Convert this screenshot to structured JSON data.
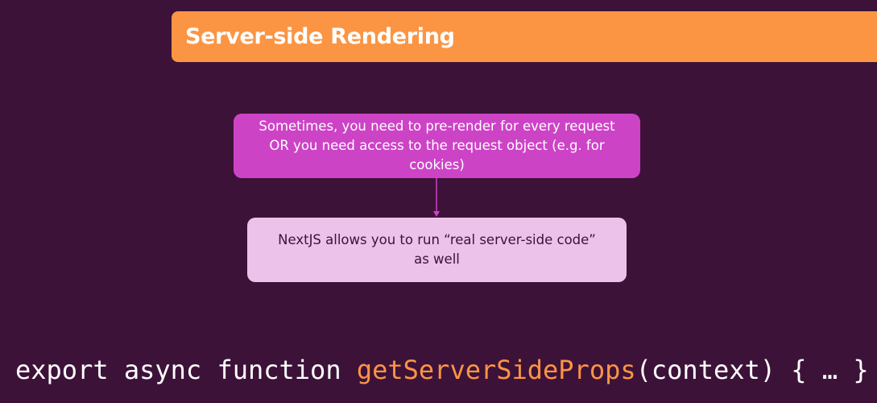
{
  "slide": {
    "title": "Server-side Rendering"
  },
  "diagram": {
    "top_box": {
      "text": "Sometimes, you need to pre-render for every request OR you need access to the request object (e.g. for cookies)"
    },
    "bottom_box": {
      "text": "NextJS allows you to run “real server-side code” as well"
    }
  },
  "code": {
    "prefix": "export async function ",
    "function_name": "getServerSideProps",
    "suffix": "(context) { … }"
  },
  "colors": {
    "background": "#3d1239",
    "accent_orange": "#fb9544",
    "box_magenta": "#cd43c6",
    "box_pink_light": "#ecc1ea"
  }
}
